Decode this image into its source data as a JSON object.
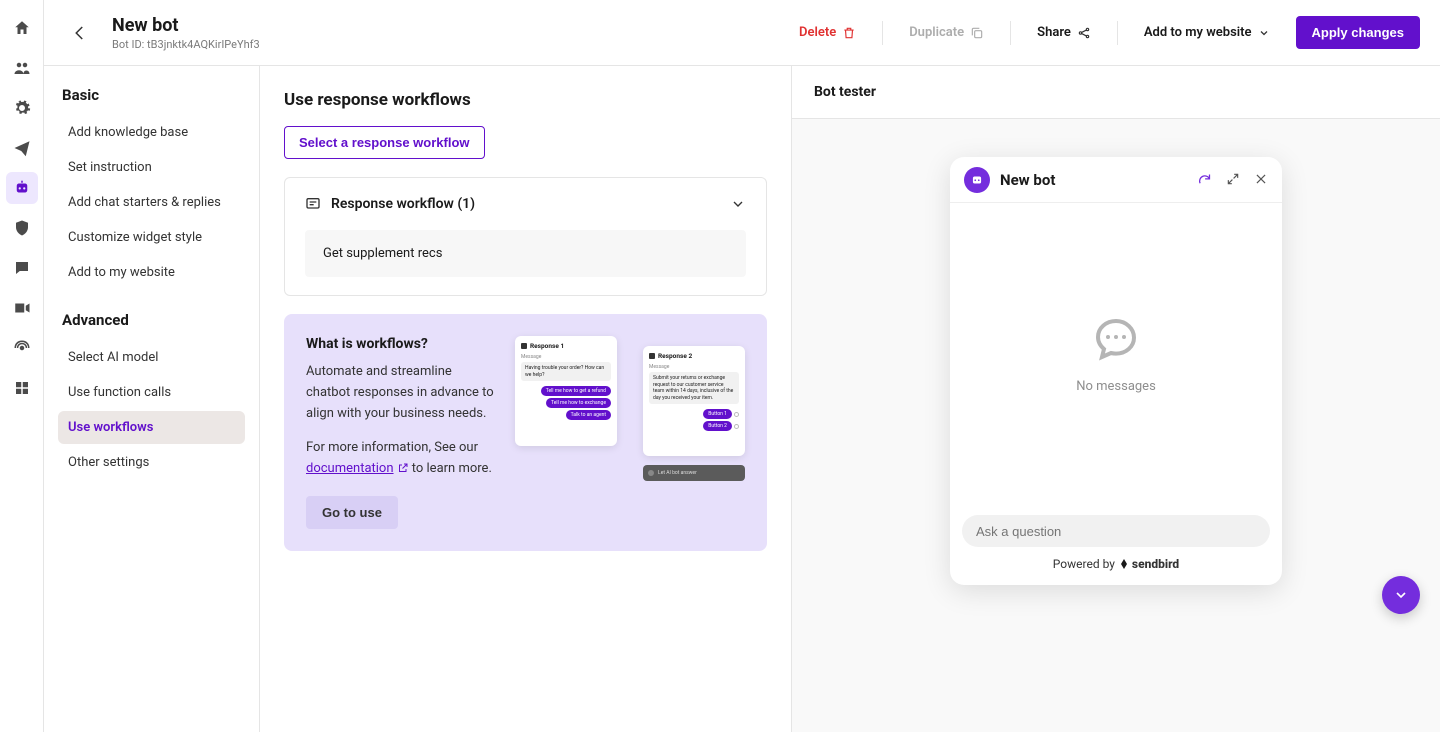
{
  "rail": [
    {
      "name": "home-icon"
    },
    {
      "name": "people-icon"
    },
    {
      "name": "gear-icon"
    },
    {
      "name": "paper-plane-icon"
    },
    {
      "name": "bot-icon",
      "active": true
    },
    {
      "name": "shield-icon"
    },
    {
      "name": "chat-icon"
    },
    {
      "name": "video-icon"
    },
    {
      "name": "broadcast-icon"
    },
    {
      "name": "app-icon"
    }
  ],
  "header": {
    "title": "New bot",
    "bot_id_label": "Bot ID: tB3jnktk4AQKirIPeYhf3",
    "delete": "Delete",
    "duplicate": "Duplicate",
    "share": "Share",
    "add_to_website": "Add to my website",
    "apply": "Apply changes"
  },
  "sidebar": {
    "basic": {
      "heading": "Basic",
      "items": [
        "Add knowledge base",
        "Set instruction",
        "Add chat starters & replies",
        "Customize widget style",
        "Add to my website"
      ]
    },
    "advanced": {
      "heading": "Advanced",
      "items": [
        {
          "label": "Select AI model",
          "active": false
        },
        {
          "label": "Use function calls",
          "active": false
        },
        {
          "label": "Use workflows",
          "active": true
        },
        {
          "label": "Other settings",
          "active": false
        }
      ]
    }
  },
  "center": {
    "heading": "Use response workflows",
    "select_btn": "Select a response workflow",
    "workflow_label": "Response workflow (1)",
    "workflow_item": "Get supplement recs",
    "info": {
      "title": "What is workflows?",
      "body": "Automate and streamline chatbot responses in advance to align with your business needs.",
      "more_prefix": "For more information, See our ",
      "doc_link": "documentation",
      "more_suffix": " to learn more.",
      "go": "Go to use",
      "mock": {
        "r1": "Response 1",
        "r2": "Response 2",
        "msg_label": "Message",
        "m1": "Having trouble your order? How can we help?",
        "m2": "Submit your returns or exchange request to our customer service team within 14 days, inclusive of the day you received your item.",
        "p1": "Tell me how to get a refund",
        "p2": "Tell me how to exchange",
        "p3": "Talk to an agent",
        "b1": "Button 1",
        "b2": "Button 2",
        "let": "Let AI bot answer"
      }
    }
  },
  "right": {
    "heading": "Bot tester",
    "widget_title": "New bot",
    "no_messages": "No messages",
    "placeholder": "Ask a question",
    "powered_prefix": "Powered by ",
    "powered_brand": "sendbird"
  }
}
